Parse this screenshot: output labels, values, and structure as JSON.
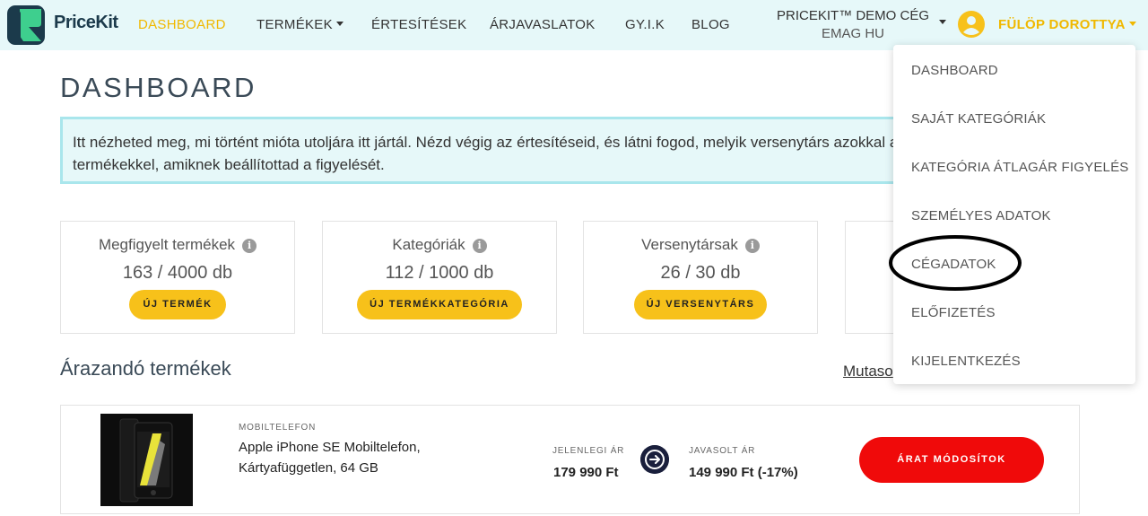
{
  "navbar": {
    "logo_text": "PriceKit",
    "items": [
      {
        "label": "DASHBOARD",
        "active": true
      },
      {
        "label": "TERMÉKEK",
        "dropdown": true
      },
      {
        "label": "ÉRTESÍTÉSEK"
      },
      {
        "label": "ÁRJAVASLATOK"
      },
      {
        "label": "GY.I.K"
      },
      {
        "label": "BLOG"
      }
    ],
    "company_name": "PRICEKIT™ DEMO CÉG",
    "company_store": "EMAG HU",
    "user_name": "FÜLÖP DOROTTYA"
  },
  "page": {
    "title": "DASHBOARD",
    "info_text": "Itt nézheted meg, mi történt mióta utoljára itt jártál. Nézd végig az értesítéseid, és látni fogod, melyik versenytárs azokkal a termékekkel, amiknek beállítottad a figyelését."
  },
  "cards": [
    {
      "title": "Megfigyelt termékek",
      "count": "163 / 4000 db",
      "button": "ÚJ TERMÉK"
    },
    {
      "title": "Kategóriák",
      "count": "112 / 1000 db",
      "button": "ÚJ TERMÉKKATEGÓRIA"
    },
    {
      "title": "Versenytársak",
      "count": "26 / 30 db",
      "button": "ÚJ VERSENYTÁRS"
    }
  ],
  "section": {
    "title": "Árazandó termékek",
    "show_link": "Mutaso"
  },
  "product": {
    "category": "MOBILTELEFON",
    "name": "Apple iPhone SE Mobiltelefon, Kártyafüggetlen, 64 GB",
    "current_price_label": "JELENLEGI ÁR",
    "current_price": "179 990 Ft",
    "suggested_price_label": "JAVASOLT ÁR",
    "suggested_price": "149 990 Ft (-17%)",
    "action_button": "ÁRAT MÓDOSÍTOK"
  },
  "dropdown": {
    "items": [
      {
        "label": "DASHBOARD"
      },
      {
        "label": "SAJÁT KATEGÓRIÁK"
      },
      {
        "label": "KATEGÓRIA ÁTLAGÁR FIGYELÉS"
      },
      {
        "label": "SZEMÉLYES ADATOK"
      },
      {
        "label": "CÉGADATOK",
        "highlighted": true
      },
      {
        "label": "ELŐFIZETÉS"
      },
      {
        "label": "KIJELENTKEZÉS"
      }
    ]
  },
  "colors": {
    "accent_yellow": "#f7c11a",
    "nav_bg": "#e6f8f9",
    "danger_red": "#f00a0a",
    "dark_navy": "#1a1f3c"
  },
  "icons": [
    "pricekit-logo-icon",
    "caret-down-icon",
    "user-avatar-icon",
    "info-icon",
    "arrow-right-icon"
  ]
}
